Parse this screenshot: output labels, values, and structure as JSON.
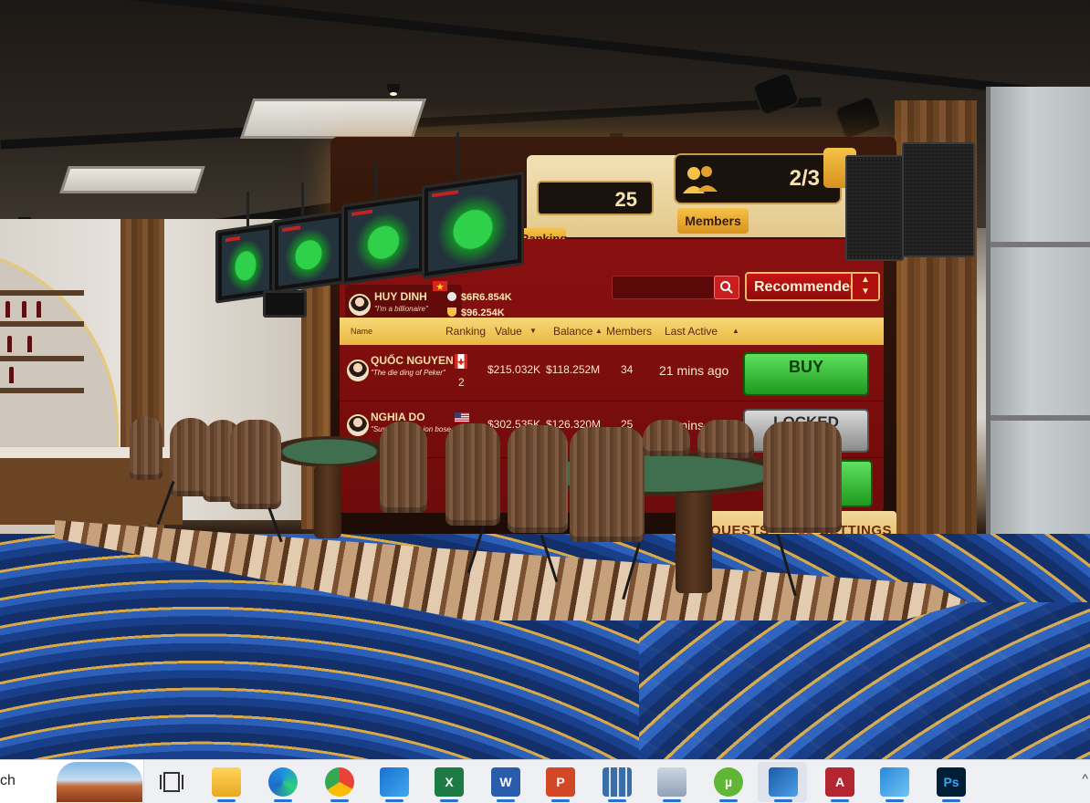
{
  "lobby": {
    "rank_value": "25",
    "ranking_tab": "Ranking",
    "members_value": "2/3",
    "members_tab": "Members",
    "search_placeholder": "",
    "sort_selected": "Recommended",
    "top_player": {
      "name": "HUY DINH",
      "subtitle": "\"I'm a billionaire\"",
      "coins": "$6R6.854K",
      "trophy": "$96.254K"
    },
    "columns": {
      "name": "Name",
      "ranking": "Ranking",
      "value": "Value",
      "balance": "Balance",
      "members": "Members",
      "last_active": "Last Active"
    },
    "rows": [
      {
        "name": "QUỐC NGUYEN",
        "subtitle": "\"The die ding of Peker\"",
        "rank": "2",
        "value": "$215.032K",
        "balance": "$118.252M",
        "members": "34",
        "last_active": "21 mins ago",
        "action": "BUY"
      },
      {
        "name": "NGHIA DO",
        "subtitle": "\"Sussim punsat ion bose thegs\"",
        "rank": "",
        "value": "$302.535K",
        "balance": "$126.320M",
        "members": "25",
        "last_active": "2 hmins ago",
        "action": "LOCKED"
      }
    ],
    "bottom": {
      "quests": "QUESTS",
      "settings": "SETTINGS"
    },
    "colors": {
      "panel_red": "#8a1010",
      "gold": "#f5c24a",
      "buy_green": "#1e9a1e"
    }
  },
  "taskbar": {
    "search_text": "ch",
    "icons": [
      "task-view-icon",
      "file-explorer-icon",
      "edge-icon",
      "chrome-icon",
      "outlook-icon",
      "excel-icon",
      "word-icon",
      "powerpoint-icon",
      "calculator-icon",
      "remote-desktop-icon",
      "utorrent-icon",
      "sketchup-icon",
      "access-icon",
      "photos-icon",
      "photoshop-icon"
    ],
    "labels": {
      "excel": "X",
      "word": "W",
      "powerpoint": "P",
      "utorrent": "µ",
      "access": "A",
      "photoshop": "Ps"
    },
    "overflow_glyph": "^"
  }
}
